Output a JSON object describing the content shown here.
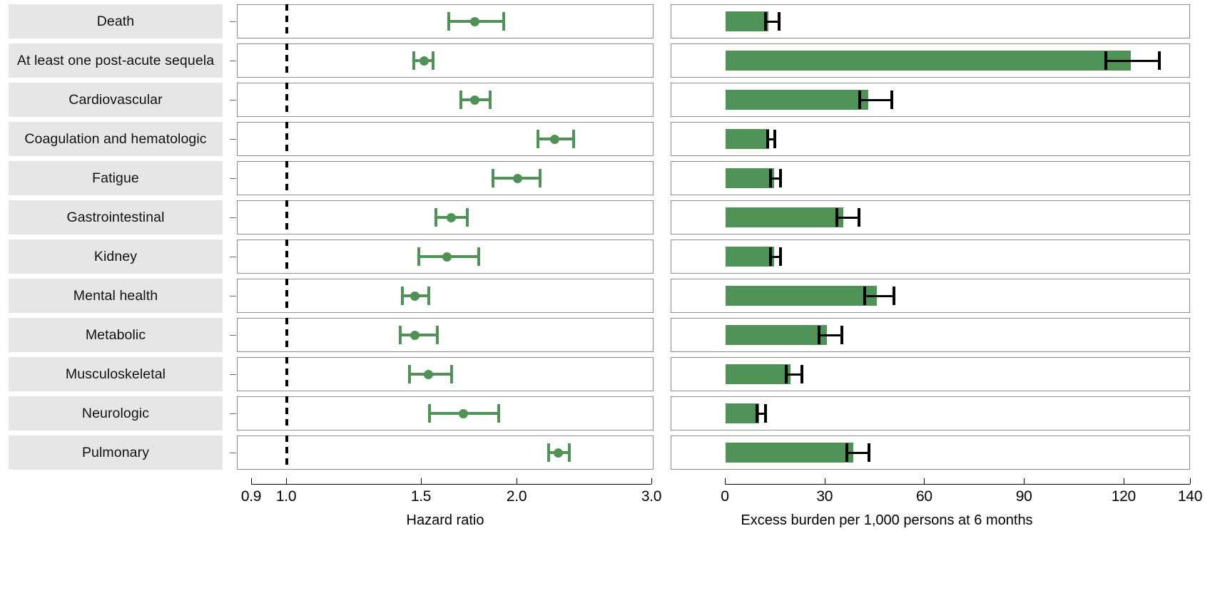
{
  "colors": {
    "accent": "#4f9257",
    "bar": "#4f9257",
    "label_background": "#e6e6e6",
    "panel_border": "#8c8c8c",
    "error_bar": "#000000",
    "reference_line": "#000000"
  },
  "left_panel": {
    "axis_title": "Hazard ratio",
    "tick_labels": [
      "0.9",
      "1.0",
      "1.5",
      "2.0",
      "3.0"
    ],
    "tick_values": [
      0.9,
      1.0,
      1.5,
      2.0,
      3.0
    ],
    "reference_value": 1.0,
    "scale": "log"
  },
  "right_panel": {
    "axis_title": "Excess burden per 1,000 persons at 6 months",
    "tick_labels": [
      "0",
      "30",
      "60",
      "90",
      "120",
      "140"
    ],
    "tick_values": [
      0,
      30,
      60,
      90,
      120,
      140
    ],
    "scale": "linear"
  },
  "rows": [
    {
      "label": "Death"
    },
    {
      "label": "At least one post-acute sequela"
    },
    {
      "label": "Cardiovascular"
    },
    {
      "label": "Coagulation and hematologic"
    },
    {
      "label": "Fatigue"
    },
    {
      "label": "Gastrointestinal"
    },
    {
      "label": "Kidney"
    },
    {
      "label": "Mental health"
    },
    {
      "label": "Metabolic"
    },
    {
      "label": "Musculoskeletal"
    },
    {
      "label": "Neurologic"
    },
    {
      "label": "Pulmonary"
    }
  ],
  "chart_data": [
    {
      "type": "scatter",
      "title": "Hazard ratio",
      "xlabel": "Hazard ratio",
      "ylabel": "",
      "xlim": [
        0.9,
        3.0
      ],
      "xscale": "log",
      "xticks": [
        0.9,
        1.0,
        1.5,
        2.0,
        3.0
      ],
      "xticklabels": [
        "0.9",
        "1.0",
        "1.5",
        "2.0",
        "3.0"
      ],
      "grid": false,
      "legend": "none",
      "annotations": [
        "dashed reference line at hazard ratio = 1.0"
      ],
      "categories": [
        "Death",
        "At least one post-acute sequela",
        "Cardiovascular",
        "Coagulation and hematologic",
        "Fatigue",
        "Gastrointestinal",
        "Kidney",
        "Mental health",
        "Metabolic",
        "Musculoskeletal",
        "Neurologic",
        "Pulmonary"
      ],
      "values": [
        1.76,
        1.51,
        1.76,
        2.24,
        2.0,
        1.64,
        1.62,
        1.47,
        1.47,
        1.53,
        1.7,
        2.26
      ],
      "ci_low": [
        1.62,
        1.46,
        1.68,
        2.12,
        1.85,
        1.56,
        1.48,
        1.41,
        1.4,
        1.44,
        1.53,
        2.19
      ],
      "ci_high": [
        1.93,
        1.56,
        1.85,
        2.38,
        2.15,
        1.73,
        1.79,
        1.54,
        1.58,
        1.65,
        1.9,
        2.35
      ]
    },
    {
      "type": "bar",
      "title": "Excess burden per 1,000 persons at 6 months",
      "xlabel": "Excess burden per 1,000 persons at 6 months",
      "ylabel": "",
      "xlim": [
        0,
        140
      ],
      "xscale": "linear",
      "xticks": [
        0,
        30,
        60,
        90,
        120,
        140
      ],
      "xticklabels": [
        "0",
        "30",
        "60",
        "90",
        "120",
        "140"
      ],
      "grid": false,
      "legend": "none",
      "orientation": "horizontal",
      "categories": [
        "Death",
        "At least one post-acute sequela",
        "Cardiovascular",
        "Coagulation and hematologic",
        "Fatigue",
        "Gastrointestinal",
        "Kidney",
        "Mental health",
        "Metabolic",
        "Musculoskeletal",
        "Neurologic",
        "Pulmonary"
      ],
      "values": [
        12.8,
        122.0,
        43.0,
        13.0,
        14.5,
        35.5,
        14.5,
        45.5,
        30.5,
        19.5,
        10.0,
        38.5
      ],
      "ci_low": [
        11.5,
        114.0,
        40.0,
        12.2,
        13.2,
        33.0,
        13.2,
        41.5,
        27.8,
        17.8,
        9.0,
        36.0
      ],
      "ci_high": [
        16.5,
        131.0,
        50.5,
        15.3,
        17.0,
        40.5,
        17.0,
        51.0,
        35.5,
        23.5,
        12.5,
        43.5
      ]
    }
  ]
}
